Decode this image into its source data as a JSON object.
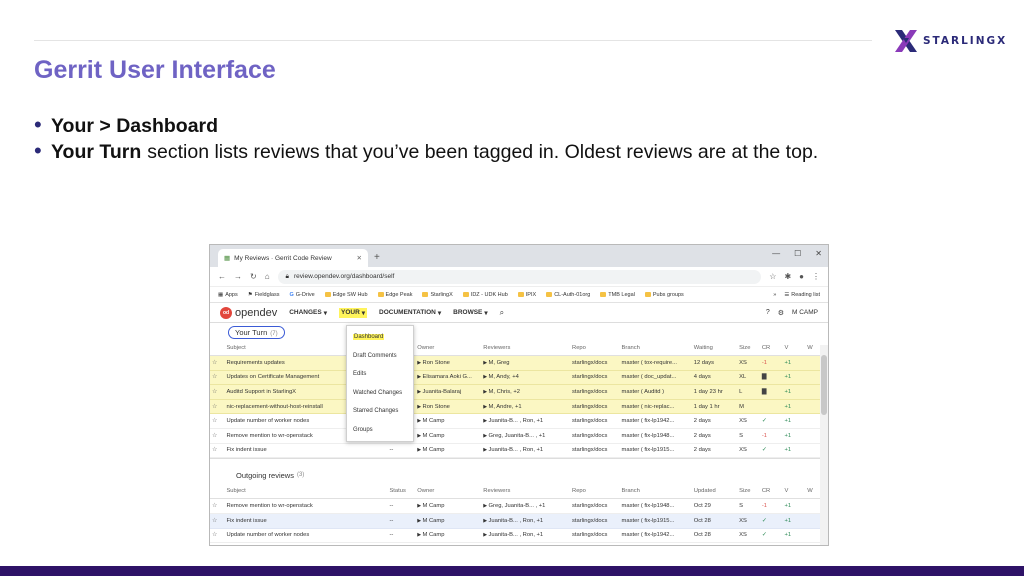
{
  "slide": {
    "title": "Gerrit User Interface",
    "logo_text": "STARLINGX",
    "bullets": [
      {
        "bold": "Your > Dashboard",
        "text": ""
      },
      {
        "bold": "Your Turn",
        "text": "section lists reviews that you’ve been tagged in. Oldest reviews are at the top."
      }
    ],
    "colors": {
      "title": "#6f63c4",
      "bottom_bar": "#2e1267",
      "highlight": "#fff45c"
    }
  },
  "browser": {
    "tab_title": "My Reviews · Gerrit Code Review",
    "url": "review.opendev.org/dashboard/self",
    "bookmarks": [
      "Apps",
      "Fieldglass",
      "G-Drive",
      "Edge SW Hub",
      "Edge Peak",
      "StarlingX",
      "IDZ - UDK Hub",
      "IPIX",
      "CL-Auth-01org",
      "TMB Legal",
      "Pubs groups"
    ],
    "bookmarks_more": "»",
    "reading_list": "Reading list"
  },
  "gerrit": {
    "brand": "opendev",
    "menus": [
      "CHANGES",
      "YOUR",
      "DOCUMENTATION",
      "BROWSE"
    ],
    "user": "M CAMP",
    "dropdown": [
      "Dashboard",
      "Draft Comments",
      "Edits",
      "Watched Changes",
      "Starred Changes",
      "Groups"
    ],
    "your_turn": {
      "title": "Your Turn",
      "count": "(7)",
      "columns": [
        "Subject",
        "Status",
        "Owner",
        "Reviewers",
        "Repo",
        "Branch",
        "Waiting",
        "Size",
        "CR",
        "V",
        "W"
      ],
      "rows": [
        {
          "subject": "Requirements updates",
          "status": "",
          "owner": "Ron Stone",
          "reviewers": "M, Greg",
          "repo": "starlingx/docs",
          "branch": "master ( tox-require...",
          "time": "12 days",
          "size": "XS",
          "cr": "-1",
          "v": "+1",
          "style": "yel"
        },
        {
          "subject": "Updates on Certificate Management",
          "status": "",
          "owner": "Elisamara Aoki G...",
          "reviewers": "M, Andy, +4",
          "repo": "starlingx/docs",
          "branch": "master ( doc_updat...",
          "time": "4 days",
          "size": "XL",
          "cr": "comment",
          "v": "+1",
          "style": "yel"
        },
        {
          "subject": "Auditd Support in StarlingX",
          "status": "",
          "owner": "Juanita-Balaraj",
          "reviewers": "M, Chris, +2",
          "repo": "starlingx/docs",
          "branch": "master ( Auditd )",
          "time": "1 day 23 hr",
          "size": "L",
          "cr": "comment",
          "v": "+1",
          "style": "yel"
        },
        {
          "subject": "nic-replacement-without-host-reinstall",
          "status": "",
          "owner": "Ron Stone",
          "reviewers": "M, Andre, +1",
          "repo": "starlingx/docs",
          "branch": "master ( nic-replac...",
          "time": "1 day 1 hr",
          "size": "M",
          "cr": "",
          "v": "+1",
          "style": "yel"
        },
        {
          "subject": "Update number of worker nodes",
          "status": "--",
          "owner": "M Camp",
          "reviewers": "Juanita-B... , Ron, +1",
          "repo": "starlingx/docs",
          "branch": "master ( fix-lp1942...",
          "time": "2 days",
          "size": "XS",
          "cr": "check",
          "v": "+1",
          "style": "plain"
        },
        {
          "subject": "Remove mention to wr-openstack",
          "status": "--",
          "owner": "M Camp",
          "reviewers": "Greg, Juanita-B... , +1",
          "repo": "starlingx/docs",
          "branch": "master ( fix-lp1948...",
          "time": "2 days",
          "size": "S",
          "cr": "-1",
          "v": "+1",
          "style": "plain"
        },
        {
          "subject": "Fix indent issue",
          "status": "--",
          "owner": "M Camp",
          "reviewers": "Juanita-B... , Ron, +1",
          "repo": "starlingx/docs",
          "branch": "master ( fix-lp1915...",
          "time": "2 days",
          "size": "XS",
          "cr": "check",
          "v": "+1",
          "style": "plain"
        }
      ]
    },
    "outgoing": {
      "title": "Outgoing reviews",
      "count": "(3)",
      "columns": [
        "Subject",
        "Status",
        "Owner",
        "Reviewers",
        "Repo",
        "Branch",
        "Updated",
        "Size",
        "CR",
        "V",
        "W"
      ],
      "rows": [
        {
          "subject": "Remove mention to wr-openstack",
          "status": "--",
          "owner": "M Camp",
          "reviewers": "Greg, Juanita-B... , +1",
          "repo": "starlingx/docs",
          "branch": "master ( fix-lp1948...",
          "time": "Oct 29",
          "size": "S",
          "cr": "-1",
          "v": "+1",
          "style": "plain"
        },
        {
          "subject": "Fix indent issue",
          "status": "--",
          "owner": "M Camp",
          "reviewers": "Juanita-B... , Ron, +1",
          "repo": "starlingx/docs",
          "branch": "master ( fix-lp1915...",
          "time": "Oct 28",
          "size": "XS",
          "cr": "check",
          "v": "+1",
          "style": "sel"
        },
        {
          "subject": "Update number of worker nodes",
          "status": "--",
          "owner": "M Camp",
          "reviewers": "Juanita-B... , Ron, +1",
          "repo": "starlingx/docs",
          "branch": "master ( fix-lp1942...",
          "time": "Oct 28",
          "size": "XS",
          "cr": "check",
          "v": "+1",
          "style": "plain"
        }
      ]
    }
  }
}
